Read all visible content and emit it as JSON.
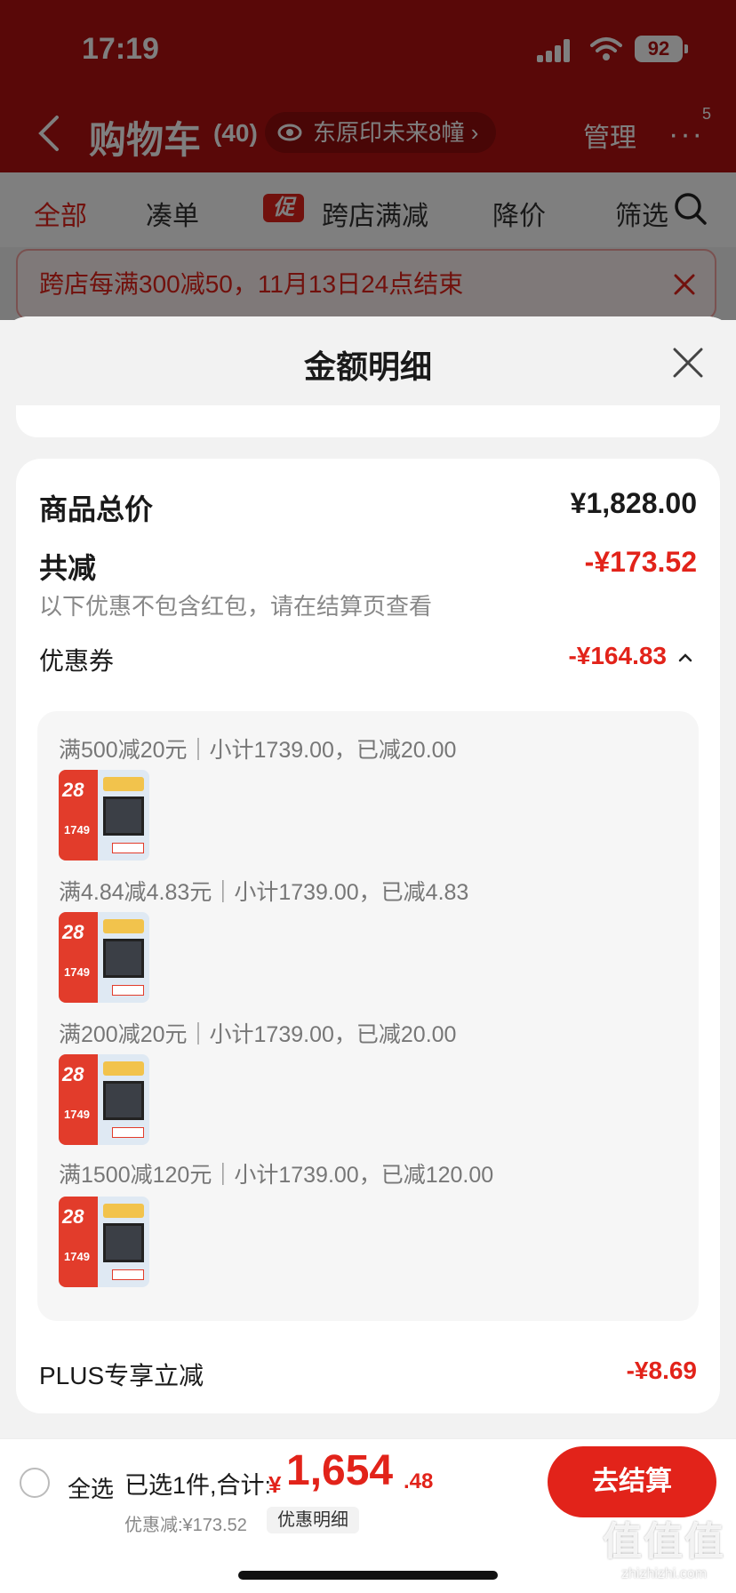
{
  "status": {
    "time": "17:19",
    "battery": "92"
  },
  "nav": {
    "title": "购物车",
    "count": "(40)",
    "location": "东原印未来8幢",
    "manage": "管理",
    "more_badge": "5"
  },
  "filters": {
    "all": "全部",
    "bundle": "凑单",
    "promo_tag": "促",
    "cross_store": "跨店满减",
    "price_drop": "降价",
    "filter": "筛选"
  },
  "promo_banner": "跨店每满300减50，11月13日24点结束",
  "sheet": {
    "title": "金额明细",
    "goods_total_label": "商品总价",
    "goods_total_value": "¥1,828.00",
    "total_discount_label": "共减",
    "total_discount_value": "-¥173.52",
    "note": "以下优惠不包含红包，请在结算页查看",
    "coupon_label": "优惠券",
    "coupon_value": "-¥164.83",
    "coupon_lines": [
      "满500减20元｜小计1739.00，已减20.00",
      "满4.84减4.83元｜小计1739.00，已减4.83",
      "满200减20元｜小计1739.00，已减20.00",
      "满1500减120元｜小计1739.00，已减120.00"
    ],
    "thumb_badge": "28",
    "thumb_price": "1749",
    "plus_label": "PLUS专享立减",
    "plus_value": "-¥8.69"
  },
  "checkout": {
    "select_all": "全选",
    "selected_text": "已选1件,合计:",
    "currency": "¥",
    "total_int": "1,654",
    "total_dec": ".48",
    "discount_text": "优惠减:¥173.52",
    "detail_chip": "优惠明细",
    "button": "去结算"
  },
  "watermark": {
    "logo": "值值值",
    "url": "zhizhizhi.com"
  }
}
